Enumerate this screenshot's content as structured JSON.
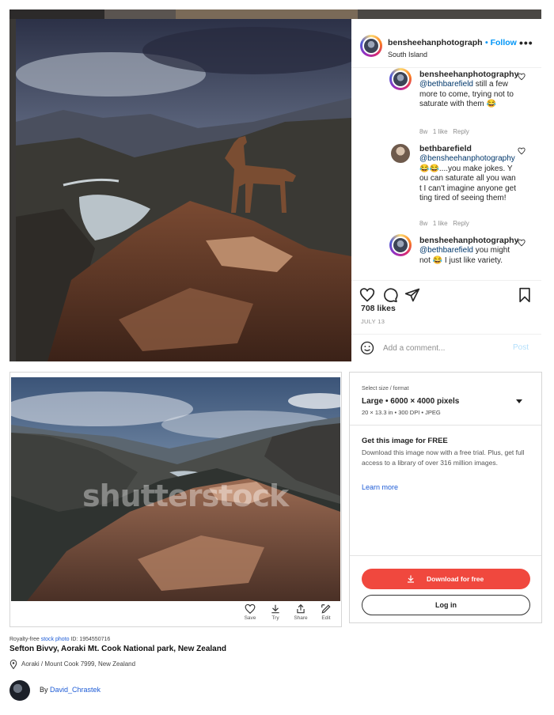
{
  "instagram": {
    "username": "bensheehanphotograph",
    "follow_sep": "•",
    "follow_label": "Follow",
    "location": "South Island",
    "more_label": "•••",
    "comments": [
      {
        "user": "bensheehanphotography",
        "mention": "@bethbarefield",
        "text": " still a few more to come, trying not to saturate with them 😂",
        "age": "8w",
        "likes": "1 like",
        "reply": "Reply"
      },
      {
        "user": "bethbarefield",
        "mention": "@bensheehanphotography",
        "text": " 😂😂....you make jokes. You can saturate all you want I can't imagine anyone getting tired of seeing them!",
        "age": "8w",
        "likes": "1 like",
        "reply": "Reply"
      },
      {
        "user": "bensheehanphotography",
        "mention": "@bethbarefield",
        "text": " you might not 😂 I just like variety."
      }
    ],
    "likes": "708 likes",
    "date": "JULY 13",
    "comment_placeholder": "Add a comment...",
    "post_label": "Post"
  },
  "shutterstock": {
    "watermark": "shutterstock",
    "tools": [
      "Save",
      "Try",
      "Share",
      "Edit"
    ],
    "size_label": "Select size / format",
    "size_value": "Large • 6000 × 4000 pixels",
    "size_sub": "20 × 13.3 in • 300 DPI • JPEG",
    "free_title": "Get this image for FREE",
    "free_text": "Download this image now with a free trial. Plus, get full access to a library of over 316 million images.",
    "learn_more": "Learn more",
    "download_label": "Download for free",
    "login_label": "Log in",
    "royalty_prefix": "Royalty-free ",
    "royalty_link": "stock photo",
    "royalty_id": " ID: 1954550716",
    "title": "Sefton Bivvy, Aoraki Mt. Cook National park, New Zealand",
    "location": "Aoraki / Mount Cook 7999, New Zealand",
    "by_prefix": "By ",
    "author": "David_Chrastek"
  },
  "colors": {
    "follow_blue": "#0095f6",
    "download_red": "#f0483e",
    "link_blue": "#1e5cd6"
  }
}
